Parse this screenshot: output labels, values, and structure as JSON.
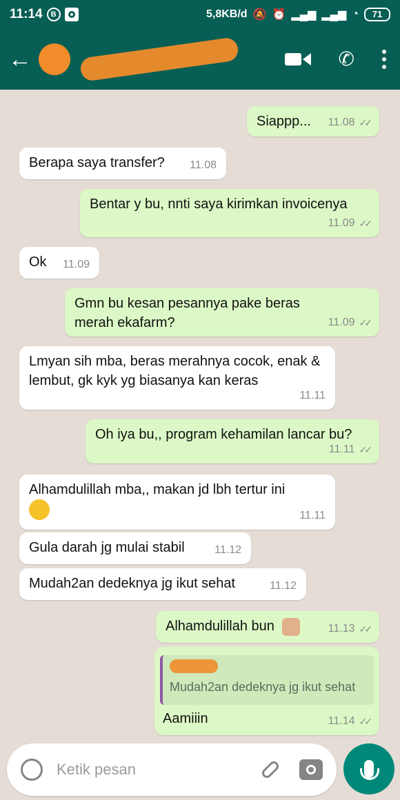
{
  "statusbar": {
    "time": "11:14",
    "net_speed": "5,8KB/d",
    "battery": "71"
  },
  "header": {
    "back_icon": "arrow-left-icon"
  },
  "messages": [
    {
      "dir": "out",
      "text": "Siappp...",
      "time": "11.08"
    },
    {
      "dir": "in",
      "text": "Berapa saya transfer?",
      "time": "11.08"
    },
    {
      "dir": "out",
      "text": "Bentar y bu, nnti saya kirimkan invoicenya",
      "time": "11.09"
    },
    {
      "dir": "in",
      "text": "Ok",
      "time": "11.09"
    },
    {
      "dir": "out",
      "text": "Gmn bu kesan pesannya pake beras merah ekafarm?",
      "time": "11.09"
    },
    {
      "dir": "in",
      "text": "Lmyan sih mba, beras merahnya cocok, enak & lembut, gk kyk yg biasanya kan keras",
      "time": "11.11"
    },
    {
      "dir": "out",
      "text": "Oh iya bu,, program kehamilan lancar bu?",
      "time": "11.11"
    },
    {
      "dir": "in",
      "text": "Alhamdulillah mba,, makan jd lbh tertur ini",
      "time": "11.11"
    },
    {
      "dir": "in",
      "text": "Gula darah jg mulai stabil",
      "time": "11.12"
    },
    {
      "dir": "in",
      "text": "Mudah2an dedeknya jg ikut sehat",
      "time": "11.12"
    },
    {
      "dir": "out",
      "text": "Alhamdulillah bun",
      "time": "11.13"
    },
    {
      "dir": "out",
      "quote": "Mudah2an dedeknya jg ikut sehat",
      "text": "Aamiiin",
      "time": "11.14"
    }
  ],
  "input": {
    "placeholder": "Ketik pesan"
  },
  "colors": {
    "header": "#075e54",
    "outgoing": "#dcf8c6",
    "incoming": "#ffffff",
    "background": "#e5ddd5",
    "mic": "#00897b"
  }
}
